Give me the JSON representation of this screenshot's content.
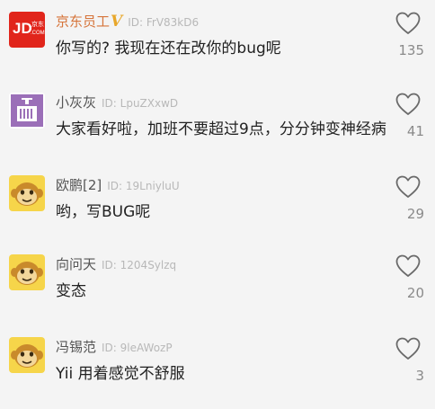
{
  "colors": {
    "background": "#f4f4f4",
    "vip_username": "#d6743a",
    "vip_badge": "#e8a72a",
    "jd_red": "#e1251b",
    "purple_avatar": "#9b6fb8",
    "monkey_yellow": "#f6d54a"
  },
  "comments": [
    {
      "avatar_icon": "jd-logo-icon",
      "avatar_text_top": "JD",
      "avatar_text_small": "京东",
      "avatar_text_com": ".COM",
      "username": "京东员工",
      "badge": "V",
      "user_id": "ID: FrV83kD6",
      "text": "你写的? 我现在还在改你的bug呢",
      "likes": "135"
    },
    {
      "avatar_icon": "purple-box-icon",
      "username": "小灰灰",
      "user_id": "ID: LpuZXxwD",
      "text": "大家看好啦，加班不要超过9点，分分钟变神经病",
      "likes": "41"
    },
    {
      "avatar_icon": "monkey-avatar-icon",
      "username": "欧鹏[2]",
      "user_id": "ID: 19LniyluU",
      "text": "哟，写BUG呢",
      "likes": "29"
    },
    {
      "avatar_icon": "monkey-avatar-icon",
      "username": "向问天",
      "user_id": "ID: 1204Sylzq",
      "text": "变态",
      "likes": "20"
    },
    {
      "avatar_icon": "monkey-avatar-icon",
      "username": "冯锡范",
      "user_id": "ID: 9leAWozP",
      "text": "Yii 用着感觉不舒服",
      "likes": "3"
    }
  ]
}
